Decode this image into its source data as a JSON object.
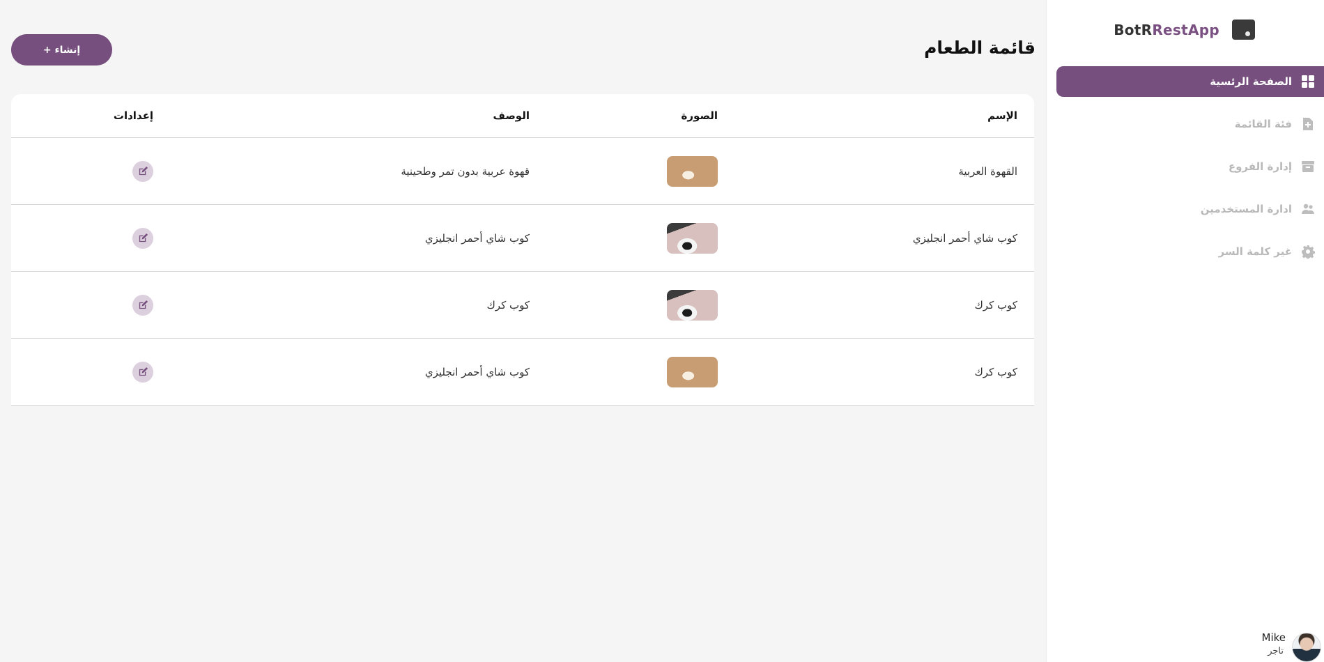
{
  "brand": {
    "part1": "BotR",
    "part2": "RestApp"
  },
  "sidebar": {
    "items": [
      {
        "label": "الصفحة الرئسية",
        "icon": "dashboard-grid-icon",
        "active": true
      },
      {
        "label": "فئة القائمة",
        "icon": "file-plus-icon",
        "active": false
      },
      {
        "label": "إدارة الفروع",
        "icon": "archive-box-icon",
        "active": false
      },
      {
        "label": "ادارة المستخدمين",
        "icon": "users-icon",
        "active": false
      },
      {
        "label": "غير كلمة السر",
        "icon": "gear-icon",
        "active": false
      }
    ]
  },
  "user": {
    "name": "Mike",
    "role": "تاجر"
  },
  "page": {
    "title": "قائمة الطعام",
    "create_label": "إنشاء +"
  },
  "table": {
    "headers": {
      "name": "الإسم",
      "image": "الصورة",
      "description": "الوصف",
      "settings": "إعدادات"
    },
    "rows": [
      {
        "name": "القهوة العربية",
        "image": "latte-thumbnail",
        "description": "قهوة عربية بدون تمر وطحينية"
      },
      {
        "name": "كوب شاي أحمر انجليزي",
        "image": "pour-over-thumbnail",
        "description": "كوب شاي أحمر انجليزي"
      },
      {
        "name": "كوب كرك",
        "image": "pour-over-thumbnail",
        "description": "كوب كرك"
      },
      {
        "name": "كوب كرك",
        "image": "latte-thumbnail",
        "description": "كوب شاي أحمر انجليزي"
      }
    ]
  },
  "colors": {
    "accent": "#764f7e",
    "edit_bg": "#dcd0df",
    "inactive_nav": "#b9b9b9"
  }
}
